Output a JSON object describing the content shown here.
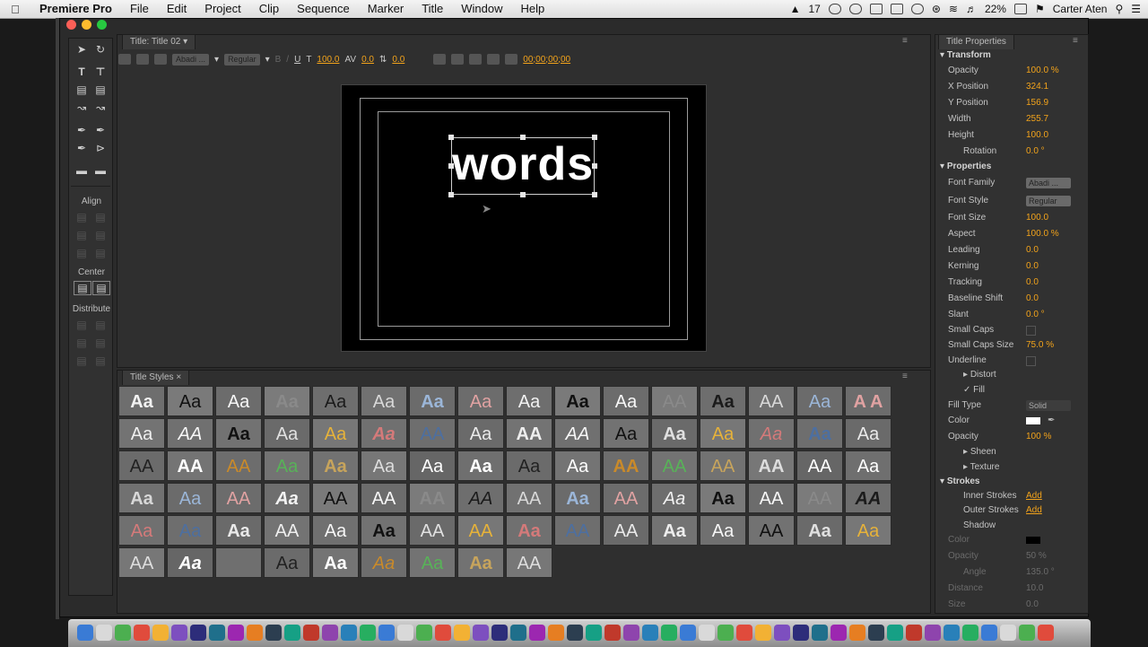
{
  "menubar": {
    "app": "Premiere Pro",
    "items": [
      "File",
      "Edit",
      "Project",
      "Clip",
      "Sequence",
      "Marker",
      "Title",
      "Window",
      "Help"
    ],
    "status": {
      "notifications": "17",
      "battery": "22%",
      "user": "Carter Aten"
    }
  },
  "title_panel": {
    "tab": "Title: Title 02",
    "font_family": "Abadi ...",
    "font_style": "Regular",
    "font_size": "100.0",
    "kerning": "0.0",
    "leading": "0.0",
    "timecode": "00;00;00;00",
    "canvas_text": "words"
  },
  "tools": {
    "align_label": "Align",
    "center_label": "Center",
    "distribute_label": "Distribute"
  },
  "styles_panel": {
    "tab": "Title Styles",
    "swatches": [
      [
        "Aa",
        "Aa",
        "Aa",
        "Aa",
        "Aa",
        "Aa",
        "Aa",
        "Aa",
        "Aa",
        "Aa",
        "Aa",
        "AA",
        "Aa",
        "AA",
        "Aa",
        "A A"
      ],
      [
        "Aa",
        "AA",
        "Aa",
        "Aa",
        "Aa",
        "Aa",
        "AA",
        "Aa",
        "AA",
        "AA",
        "Aa",
        "Aa",
        "Aa",
        "Aa",
        "Aa",
        "Aa"
      ],
      [
        "AA",
        "AA",
        "AA",
        "Aa",
        "Aa",
        "Aa",
        "Aa",
        "Aa",
        "Aa",
        "Aa",
        "AA",
        "AA",
        "AA",
        "AA",
        "AA",
        "Aa"
      ],
      [
        "Aa",
        "Aa",
        "AA",
        "Aa",
        "AA",
        "AA",
        "AA",
        "AA",
        "AA",
        "Aa",
        "AA",
        "Aa",
        "Aa",
        "AA",
        "AA",
        "AA"
      ],
      [
        "Aa",
        "Aa",
        "Aa",
        "AA",
        "Aa",
        "Aa",
        "AA",
        "AA",
        "Aa",
        "AA",
        "AA",
        "Aa",
        "Aa",
        "AA",
        "Aa",
        "Aa"
      ],
      [
        "AA",
        "Aa",
        "",
        "Aa",
        "Aa",
        "Aa",
        "Aa",
        "Aa",
        "AA"
      ]
    ]
  },
  "properties": {
    "tab": "Title Properties",
    "transform": {
      "header": "Transform",
      "opacity": "100.0 %",
      "x_position": "324.1",
      "y_position": "156.9",
      "width": "255.7",
      "height": "100.0",
      "rotation": "0.0 °"
    },
    "props": {
      "header": "Properties",
      "font_family": "Abadi ...",
      "font_style": "Regular",
      "font_size": "100.0",
      "aspect": "100.0 %",
      "leading": "0.0",
      "kerning": "0.0",
      "tracking": "0.0",
      "baseline_shift": "0.0",
      "slant": "0.0 °",
      "small_caps_size": "75.0 %"
    },
    "labels": {
      "opacity": "Opacity",
      "x_position": "X Position",
      "y_position": "Y Position",
      "width": "Width",
      "height": "Height",
      "rotation": "Rotation",
      "font_family": "Font Family",
      "font_style": "Font Style",
      "font_size": "Font Size",
      "aspect": "Aspect",
      "leading": "Leading",
      "kerning": "Kerning",
      "tracking": "Tracking",
      "baseline_shift": "Baseline Shift",
      "slant": "Slant",
      "small_caps": "Small Caps",
      "small_caps_size": "Small Caps Size",
      "underline": "Underline",
      "distort": "Distort",
      "fill": "Fill",
      "fill_type": "Fill Type",
      "color": "Color",
      "fill_opacity": "Opacity",
      "sheen": "Sheen",
      "texture": "Texture",
      "strokes": "Strokes",
      "inner_strokes": "Inner Strokes",
      "outer_strokes": "Outer Strokes",
      "shadow": "Shadow",
      "shadow_color": "Color",
      "shadow_opacity": "Opacity",
      "angle": "Angle",
      "distance": "Distance",
      "size": "Size"
    },
    "fill": {
      "fill_type": "Solid",
      "opacity": "100 %"
    },
    "strokes": {
      "add": "Add"
    },
    "shadow": {
      "opacity": "50 %",
      "angle": "135.0 °",
      "distance": "10.0",
      "size": "0.0"
    }
  },
  "colors": {
    "accent": "#f2a31b",
    "panel": "#333333"
  }
}
